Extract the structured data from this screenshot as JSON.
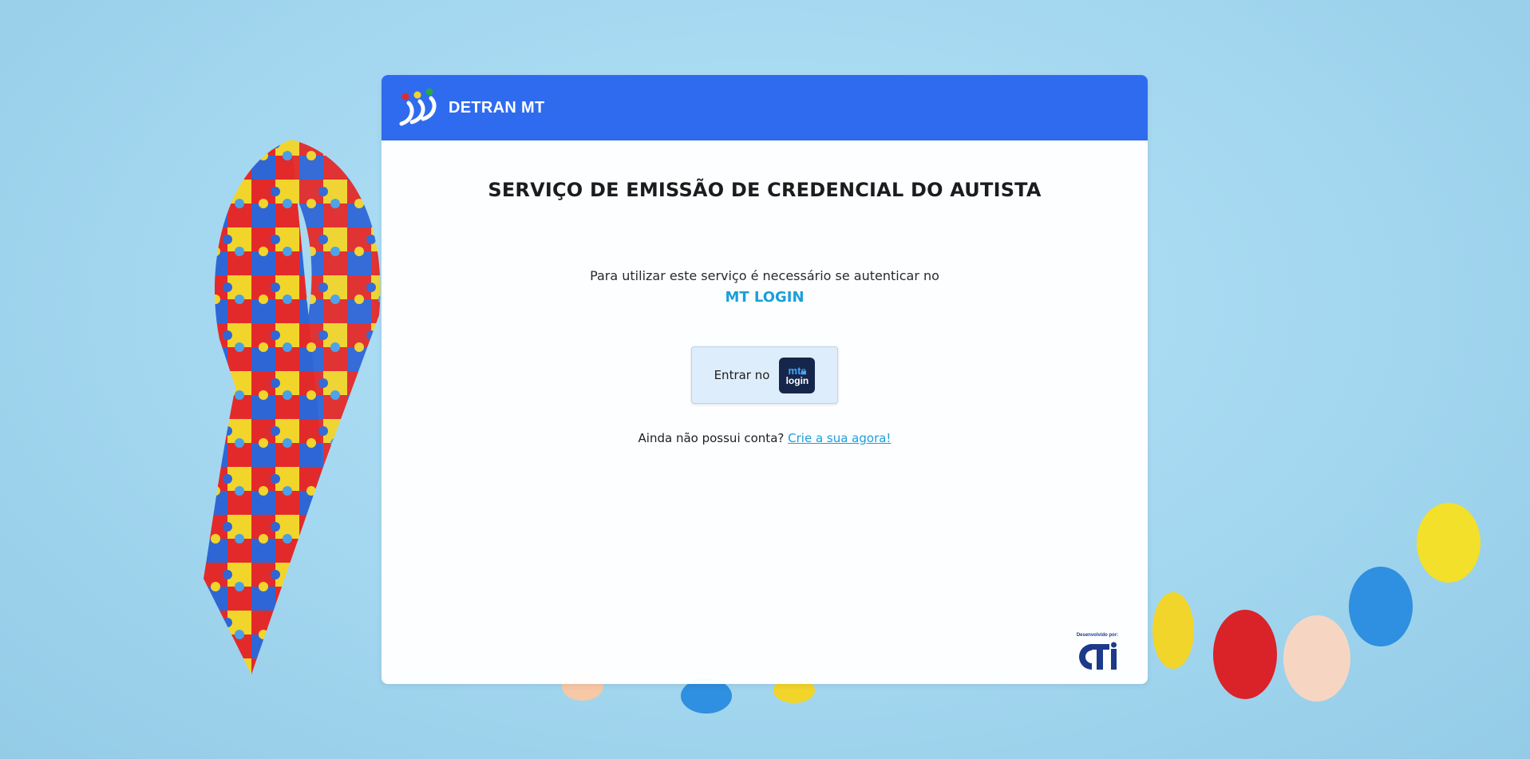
{
  "header": {
    "logo_text": "DETRAN MT"
  },
  "main": {
    "title": "SERVIÇO DE EMISSÃO DE CREDENCIAL DO AUTISTA",
    "intro_text": "Para utilizar este serviço é necessário se autenticar no",
    "intro_highlight": "MT LOGIN",
    "login_button": {
      "label": "Entrar no",
      "badge_line1": "mt",
      "badge_line2": "login"
    },
    "signup": {
      "question": "Ainda não possui conta?",
      "link_text": "Crie a sua agora!"
    }
  },
  "footer": {
    "developer_caption": "Desenvolvido por:",
    "developer_logo_text": "CTI"
  },
  "colors": {
    "header_bg": "#2f6bef",
    "accent_link": "#1a9fdb",
    "button_bg": "#deedfb",
    "badge_bg": "#16264a",
    "page_bg": "#a9dcf2"
  }
}
